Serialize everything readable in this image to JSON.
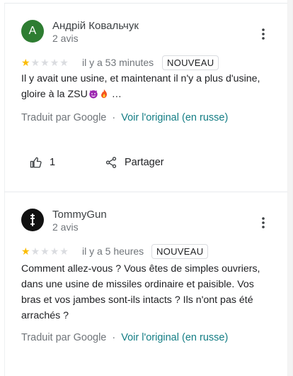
{
  "reviews": [
    {
      "avatar_letter": "A",
      "avatar_color": "#2e7d32",
      "author": "Андрій Ковальчук",
      "review_count": "2 avis",
      "rating": 1,
      "time": "il y a 53 minutes",
      "badge": "NOUVEAU",
      "text": "Il y avait une usine, et maintenant il n'y a plus d'usine, gloire à la ZSU",
      "text_ellipsis": " …",
      "translated_by": "Traduit par Google",
      "see_original": "Voir l'original (en russe)",
      "likes": "1",
      "share_label": "Partager"
    },
    {
      "avatar_color": "#111111",
      "author": "TommyGun",
      "review_count": "2 avis",
      "rating": 1,
      "time": "il y a 5 heures",
      "badge": "NOUVEAU",
      "text": "Comment allez-vous ? Vous êtes de simples ouvriers, dans une usine de missiles ordinaire et paisible. Vos bras et vos jambes sont-ils intacts ? Ils n'ont pas été arrachés ?",
      "translated_by": "Traduit par Google",
      "see_original": "Voir l'original (en russe)"
    }
  ],
  "separator": "·",
  "colors": {
    "star": "#fbbc04",
    "star_empty": "#dadce0",
    "link": "#137d84"
  }
}
